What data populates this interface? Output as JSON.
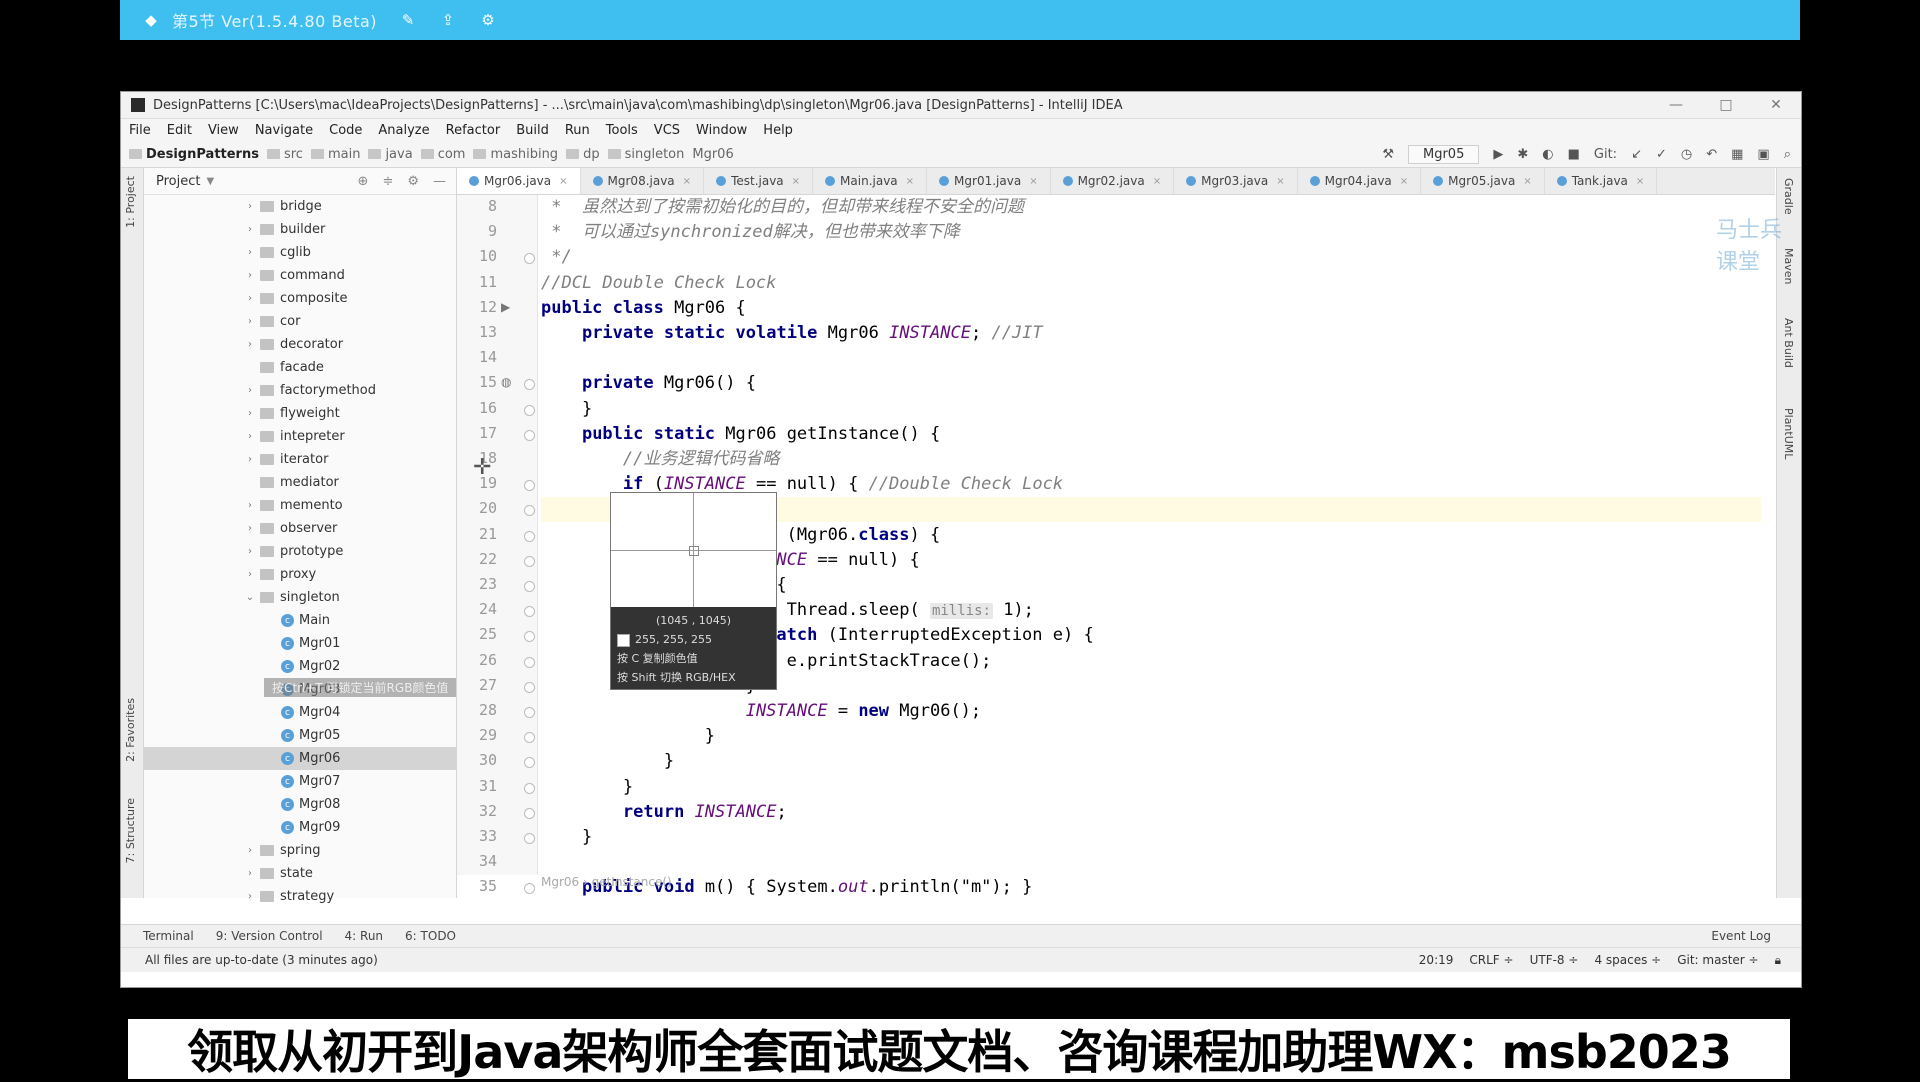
{
  "recorder": {
    "title": "第5节 Ver(1.5.4.80 Beta)",
    "icons": [
      "recorder-logo-icon",
      "edit-icon",
      "export-icon",
      "settings-icon"
    ]
  },
  "window": {
    "title": "DesignPatterns [C:\\Users\\mac\\IdeaProjects\\DesignPatterns] - ...\\src\\main\\java\\com\\mashibing\\dp\\singleton\\Mgr06.java [DesignPatterns] - IntelliJ IDEA",
    "controls": [
      "—",
      "□",
      "✕"
    ]
  },
  "menu": [
    "File",
    "Edit",
    "View",
    "Navigate",
    "Code",
    "Analyze",
    "Refactor",
    "Build",
    "Run",
    "Tools",
    "VCS",
    "Window",
    "Help"
  ],
  "breadcrumbs": [
    "DesignPatterns",
    "src",
    "main",
    "java",
    "com",
    "mashibing",
    "dp",
    "singleton",
    "Mgr06"
  ],
  "toolbar": {
    "run_config": "Mgr05",
    "git_label": "Git:"
  },
  "project_panel": {
    "title": "Project",
    "tree": [
      {
        "label": "bridge",
        "type": "folder",
        "expandable": true
      },
      {
        "label": "builder",
        "type": "folder",
        "expandable": true
      },
      {
        "label": "cglib",
        "type": "folder",
        "expandable": true
      },
      {
        "label": "command",
        "type": "folder",
        "expandable": true
      },
      {
        "label": "composite",
        "type": "folder",
        "expandable": true
      },
      {
        "label": "cor",
        "type": "folder",
        "expandable": true
      },
      {
        "label": "decorator",
        "type": "folder",
        "expandable": true
      },
      {
        "label": "facade",
        "type": "folder",
        "expandable": false
      },
      {
        "label": "factorymethod",
        "type": "folder",
        "expandable": true
      },
      {
        "label": "flyweight",
        "type": "folder",
        "expandable": true
      },
      {
        "label": "intepreter",
        "type": "folder",
        "expandable": true
      },
      {
        "label": "iterator",
        "type": "folder",
        "expandable": true
      },
      {
        "label": "mediator",
        "type": "folder",
        "expandable": false
      },
      {
        "label": "memento",
        "type": "folder",
        "expandable": true
      },
      {
        "label": "observer",
        "type": "folder",
        "expandable": true
      },
      {
        "label": "prototype",
        "type": "folder",
        "expandable": true
      },
      {
        "label": "proxy",
        "type": "folder",
        "expandable": true
      },
      {
        "label": "singleton",
        "type": "folder",
        "expandable": true,
        "expanded": true
      },
      {
        "label": "Main",
        "type": "class"
      },
      {
        "label": "Mgr01",
        "type": "class"
      },
      {
        "label": "Mgr02",
        "type": "class"
      },
      {
        "label": "Mgr03",
        "type": "class"
      },
      {
        "label": "Mgr04",
        "type": "class"
      },
      {
        "label": "Mgr05",
        "type": "class"
      },
      {
        "label": "Mgr06",
        "type": "class",
        "selected": true
      },
      {
        "label": "Mgr07",
        "type": "class"
      },
      {
        "label": "Mgr08",
        "type": "class"
      },
      {
        "label": "Mgr09",
        "type": "class"
      },
      {
        "label": "spring",
        "type": "folder",
        "expandable": true
      },
      {
        "label": "state",
        "type": "folder",
        "expandable": true
      },
      {
        "label": "strategy",
        "type": "folder",
        "expandable": true
      }
    ],
    "overlay_tip": "按Ctrl+T 可锁定当前RGB颜色值"
  },
  "tabs": [
    "Mgr06.java",
    "Mgr08.java",
    "Test.java",
    "Main.java",
    "Mgr01.java",
    "Mgr02.java",
    "Mgr03.java",
    "Mgr04.java",
    "Mgr05.java",
    "Tank.java"
  ],
  "active_tab": "Mgr06.java",
  "editor": {
    "lines": [
      {
        "n": "8",
        "t": " *  虽然达到了按需初始化的目的，但却带来线程不安全的问题"
      },
      {
        "n": "9",
        "t": " *  可以通过synchronized解决，但也带来效率下降"
      },
      {
        "n": "10",
        "t": " */"
      },
      {
        "n": "11",
        "t": "//DCL Double Check Lock"
      },
      {
        "n": "12",
        "t": "public class Mgr06 {"
      },
      {
        "n": "13",
        "t": "    private static volatile Mgr06 INSTANCE; //JIT"
      },
      {
        "n": "14",
        "t": ""
      },
      {
        "n": "15",
        "t": "    private Mgr06() {"
      },
      {
        "n": "16",
        "t": "    }"
      },
      {
        "n": "17",
        "t": "    public static Mgr06 getInstance() {"
      },
      {
        "n": "18",
        "t": "        //业务逻辑代码省略"
      },
      {
        "n": "19",
        "t": "        if (INSTANCE == null) { //Double Check Lock"
      },
      {
        "n": "20",
        "t": ""
      },
      {
        "n": "21",
        "t": "                    zed (Mgr06.class) {"
      },
      {
        "n": "22",
        "t": "                    STANCE == null) {"
      },
      {
        "n": "23",
        "t": "                    ry {"
      },
      {
        "n": "24",
        "t": "                        Thread.sleep( millis: 1);"
      },
      {
        "n": "25",
        "t": "                    } catch (InterruptedException e) {"
      },
      {
        "n": "26",
        "t": "                        e.printStackTrace();"
      },
      {
        "n": "27",
        "t": "                    }"
      },
      {
        "n": "28",
        "t": "                    INSTANCE = new Mgr06();"
      },
      {
        "n": "29",
        "t": "                }"
      },
      {
        "n": "30",
        "t": "            }"
      },
      {
        "n": "31",
        "t": "        }"
      },
      {
        "n": "32",
        "t": "        return INSTANCE;"
      },
      {
        "n": "33",
        "t": "    }"
      },
      {
        "n": "34",
        "t": ""
      },
      {
        "n": "35",
        "t": "    public void m() { System.out.println(\"m\"); }"
      }
    ],
    "breadcrumb": "Mgr06 › getInstance()"
  },
  "magnifier": {
    "coords": "(1045 , 1045)",
    "rgb": "255, 255, 255",
    "hint1": "按 C 复制颜色值",
    "hint2": "按 Shift 切换 RGB/HEX"
  },
  "tool_windows": [
    "Terminal",
    "9: Version Control",
    "4: Run",
    "6: TODO"
  ],
  "event_log": "Event Log",
  "status": {
    "message": "All files are up-to-date (3 minutes ago)",
    "position": "20:19",
    "line_sep": "CRLF ÷",
    "encoding": "UTF-8 ÷",
    "indent": "4 spaces ÷",
    "git": "Git: master ÷"
  },
  "left_strip": [
    "1: Project",
    "2: Favorites",
    "7: Structure"
  ],
  "right_strip": [
    "Gradle",
    "Maven",
    "Ant Build",
    "PlantUML"
  ],
  "watermark": "马士兵课堂",
  "banner": "领取从初开到Java架构师全套面试题文档、咨询课程加助理WX：msb2023"
}
